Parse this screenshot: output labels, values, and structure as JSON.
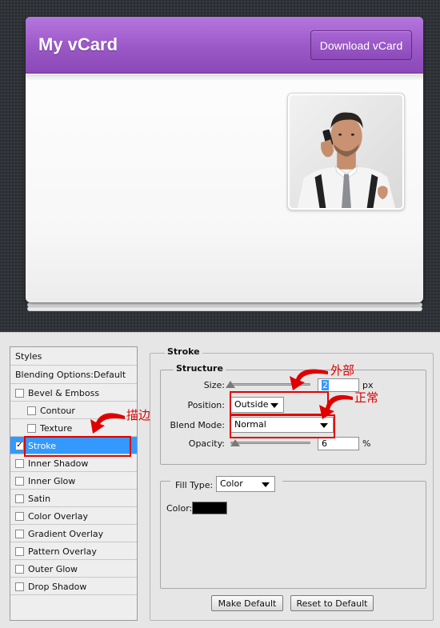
{
  "vcard": {
    "title": "My vCard",
    "download_label": "Download vCard",
    "photo_alt": "profile photo"
  },
  "dialog": {
    "styles_header": "Styles",
    "blending_options": "Blending Options:Default",
    "items": [
      {
        "label": "Bevel & Emboss",
        "checked": false,
        "indent": false
      },
      {
        "label": "Contour",
        "checked": false,
        "indent": true
      },
      {
        "label": "Texture",
        "checked": false,
        "indent": true
      },
      {
        "label": "Stroke",
        "checked": true,
        "indent": false,
        "selected": true
      },
      {
        "label": "Inner Shadow",
        "checked": false,
        "indent": false
      },
      {
        "label": "Inner Glow",
        "checked": false,
        "indent": false
      },
      {
        "label": "Satin",
        "checked": false,
        "indent": false
      },
      {
        "label": "Color Overlay",
        "checked": false,
        "indent": false
      },
      {
        "label": "Gradient Overlay",
        "checked": false,
        "indent": false
      },
      {
        "label": "Pattern Overlay",
        "checked": false,
        "indent": false
      },
      {
        "label": "Outer Glow",
        "checked": false,
        "indent": false
      },
      {
        "label": "Drop Shadow",
        "checked": false,
        "indent": false
      }
    ],
    "check_mark": "✓",
    "stroke": {
      "group_title": "Stroke",
      "structure_legend": "Structure",
      "size_label": "Size:",
      "size_value": "2",
      "size_unit": "px",
      "position_label": "Position:",
      "position_value": "Outside",
      "blend_label": "Blend Mode:",
      "blend_value": "Normal",
      "opacity_label": "Opacity:",
      "opacity_value": "6",
      "opacity_unit": "%",
      "size_slider_fraction": 0.0,
      "opacity_slider_fraction": 0.06,
      "fill_type_label": "Fill Type:",
      "fill_type_value": "Color",
      "color_label": "Color:",
      "color_value": "#000000"
    },
    "buttons": {
      "make_default": "Make Default",
      "reset_default": "Reset to Default"
    }
  },
  "annotations": {
    "outside": "外部",
    "normal": "正常",
    "stroke": "描边",
    "color": "#e00000"
  },
  "colors": {
    "header_purple": "#9a58c7",
    "selection_blue": "#3399ff",
    "background_dark": "#2f3338"
  }
}
